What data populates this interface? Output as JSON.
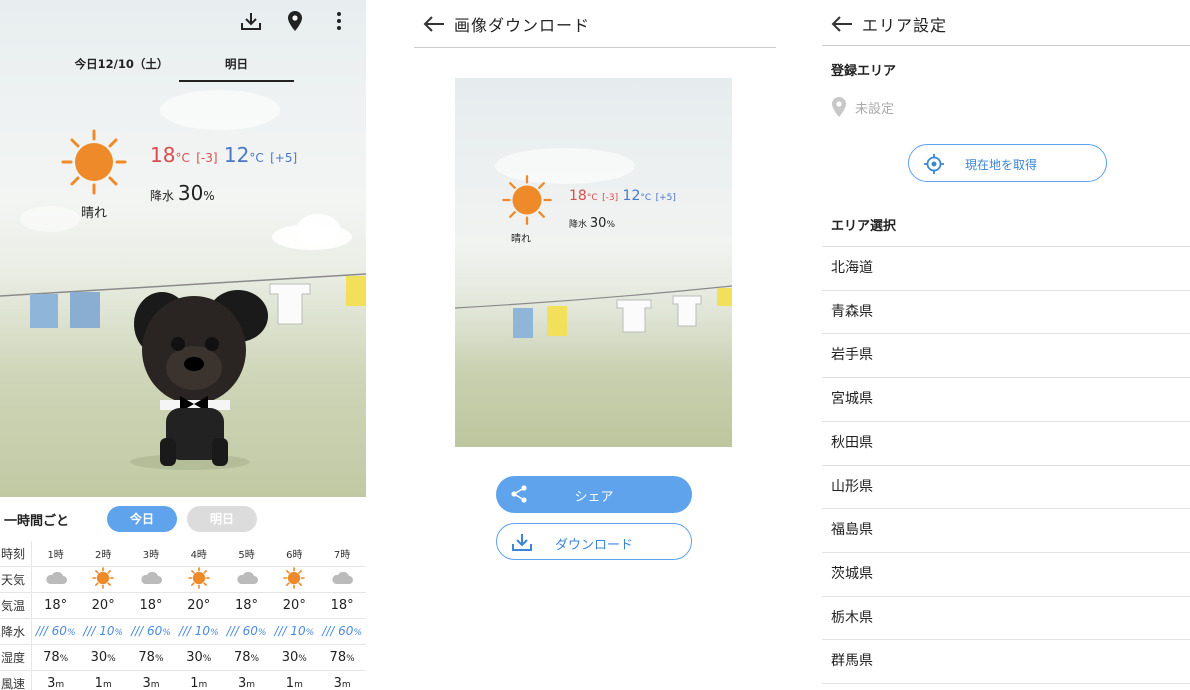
{
  "panel_weather": {
    "date_tabs": [
      "今日12/10（土）",
      "明日"
    ],
    "forecast": {
      "condition": "晴れ",
      "high": "18",
      "high_diff": "[-3]",
      "low": "12",
      "low_diff": "[+5]",
      "unit": "°C",
      "rain_label": "降水",
      "rain_value": "30",
      "rain_unit": "%"
    },
    "hourly": {
      "title": "一時間ごと",
      "tab_today": "今日",
      "tab_tomorrow": "明日",
      "row_labels": [
        "時刻",
        "天気",
        "気温",
        "降水",
        "湿度",
        "風速"
      ],
      "hours": [
        "1時",
        "2時",
        "3時",
        "4時",
        "5時",
        "6時",
        "7時"
      ],
      "weather_icons": [
        "cloud-icon",
        "sun-icon",
        "cloud-icon",
        "sun-icon",
        "cloud-icon",
        "sun-icon",
        "cloud-icon"
      ],
      "temps": [
        "18°",
        "20°",
        "18°",
        "20°",
        "18°",
        "20°",
        "18°"
      ],
      "precip": [
        "60",
        "10",
        "60",
        "10",
        "60",
        "10",
        "60"
      ],
      "humidity": [
        "78",
        "30",
        "78",
        "30",
        "78",
        "30",
        "78"
      ],
      "wind": [
        "3",
        "1",
        "3",
        "1",
        "3",
        "1",
        "3"
      ],
      "percent": "%",
      "meter": "m"
    }
  },
  "panel_download": {
    "title": "画像ダウンロード",
    "preview": {
      "condition": "晴れ",
      "high": "18",
      "high_diff": "[-3]",
      "low": "12",
      "low_diff": "[+5]",
      "unit": "°C",
      "rain_label": "降水",
      "rain_value": "30",
      "rain_unit": "%"
    },
    "share_label": "シェア",
    "download_label": "ダウンロード"
  },
  "panel_area": {
    "title": "エリア設定",
    "registered_title": "登録エリア",
    "unset_label": "未設定",
    "get_location_label": "現在地を取得",
    "select_title": "エリア選択",
    "prefectures": [
      "北海道",
      "青森県",
      "岩手県",
      "宮城県",
      "秋田県",
      "山形県",
      "福島県",
      "茨城県",
      "栃木県",
      "群馬県"
    ]
  },
  "colors": {
    "accent": "#5ea3ec",
    "high_temp": "#d94d4d",
    "low_temp": "#4a78c8",
    "sun": "#ee8a2a"
  }
}
